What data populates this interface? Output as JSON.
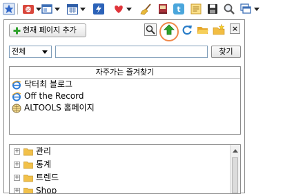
{
  "toolbar": {
    "icons": [
      "favorites-star-icon",
      "ie-toolbar-icon",
      "window-icon",
      "calendar-icon",
      "flash-icon",
      "heart-icon",
      "broom-icon",
      "book-icon",
      "twitter-icon",
      "notes-icon",
      "save-icon",
      "magnifier-icon",
      "window-stack-icon"
    ]
  },
  "panel": {
    "add_button_label": "현재 페이지 추가",
    "close_label": "×",
    "filter": {
      "selected": "전체",
      "input_value": "",
      "find_label": "찾기"
    },
    "favorites": {
      "header": "자주가는 즐겨찾기",
      "items": [
        {
          "label": "닥터최 블로그",
          "icon": "ie-icon"
        },
        {
          "label": "Off the Record",
          "icon": "ie-icon"
        },
        {
          "label": "ALTOOLS 홈페이지",
          "icon": "globe-icon"
        }
      ]
    },
    "tree": {
      "items": [
        {
          "label": "관리"
        },
        {
          "label": "통계"
        },
        {
          "label": "트렌드"
        },
        {
          "label": "Shop"
        }
      ]
    }
  },
  "colors": {
    "highlight_ring": "#f0884a",
    "up_arrow_green": "#2fa12c",
    "folder_yellow": "#f2c14a"
  }
}
